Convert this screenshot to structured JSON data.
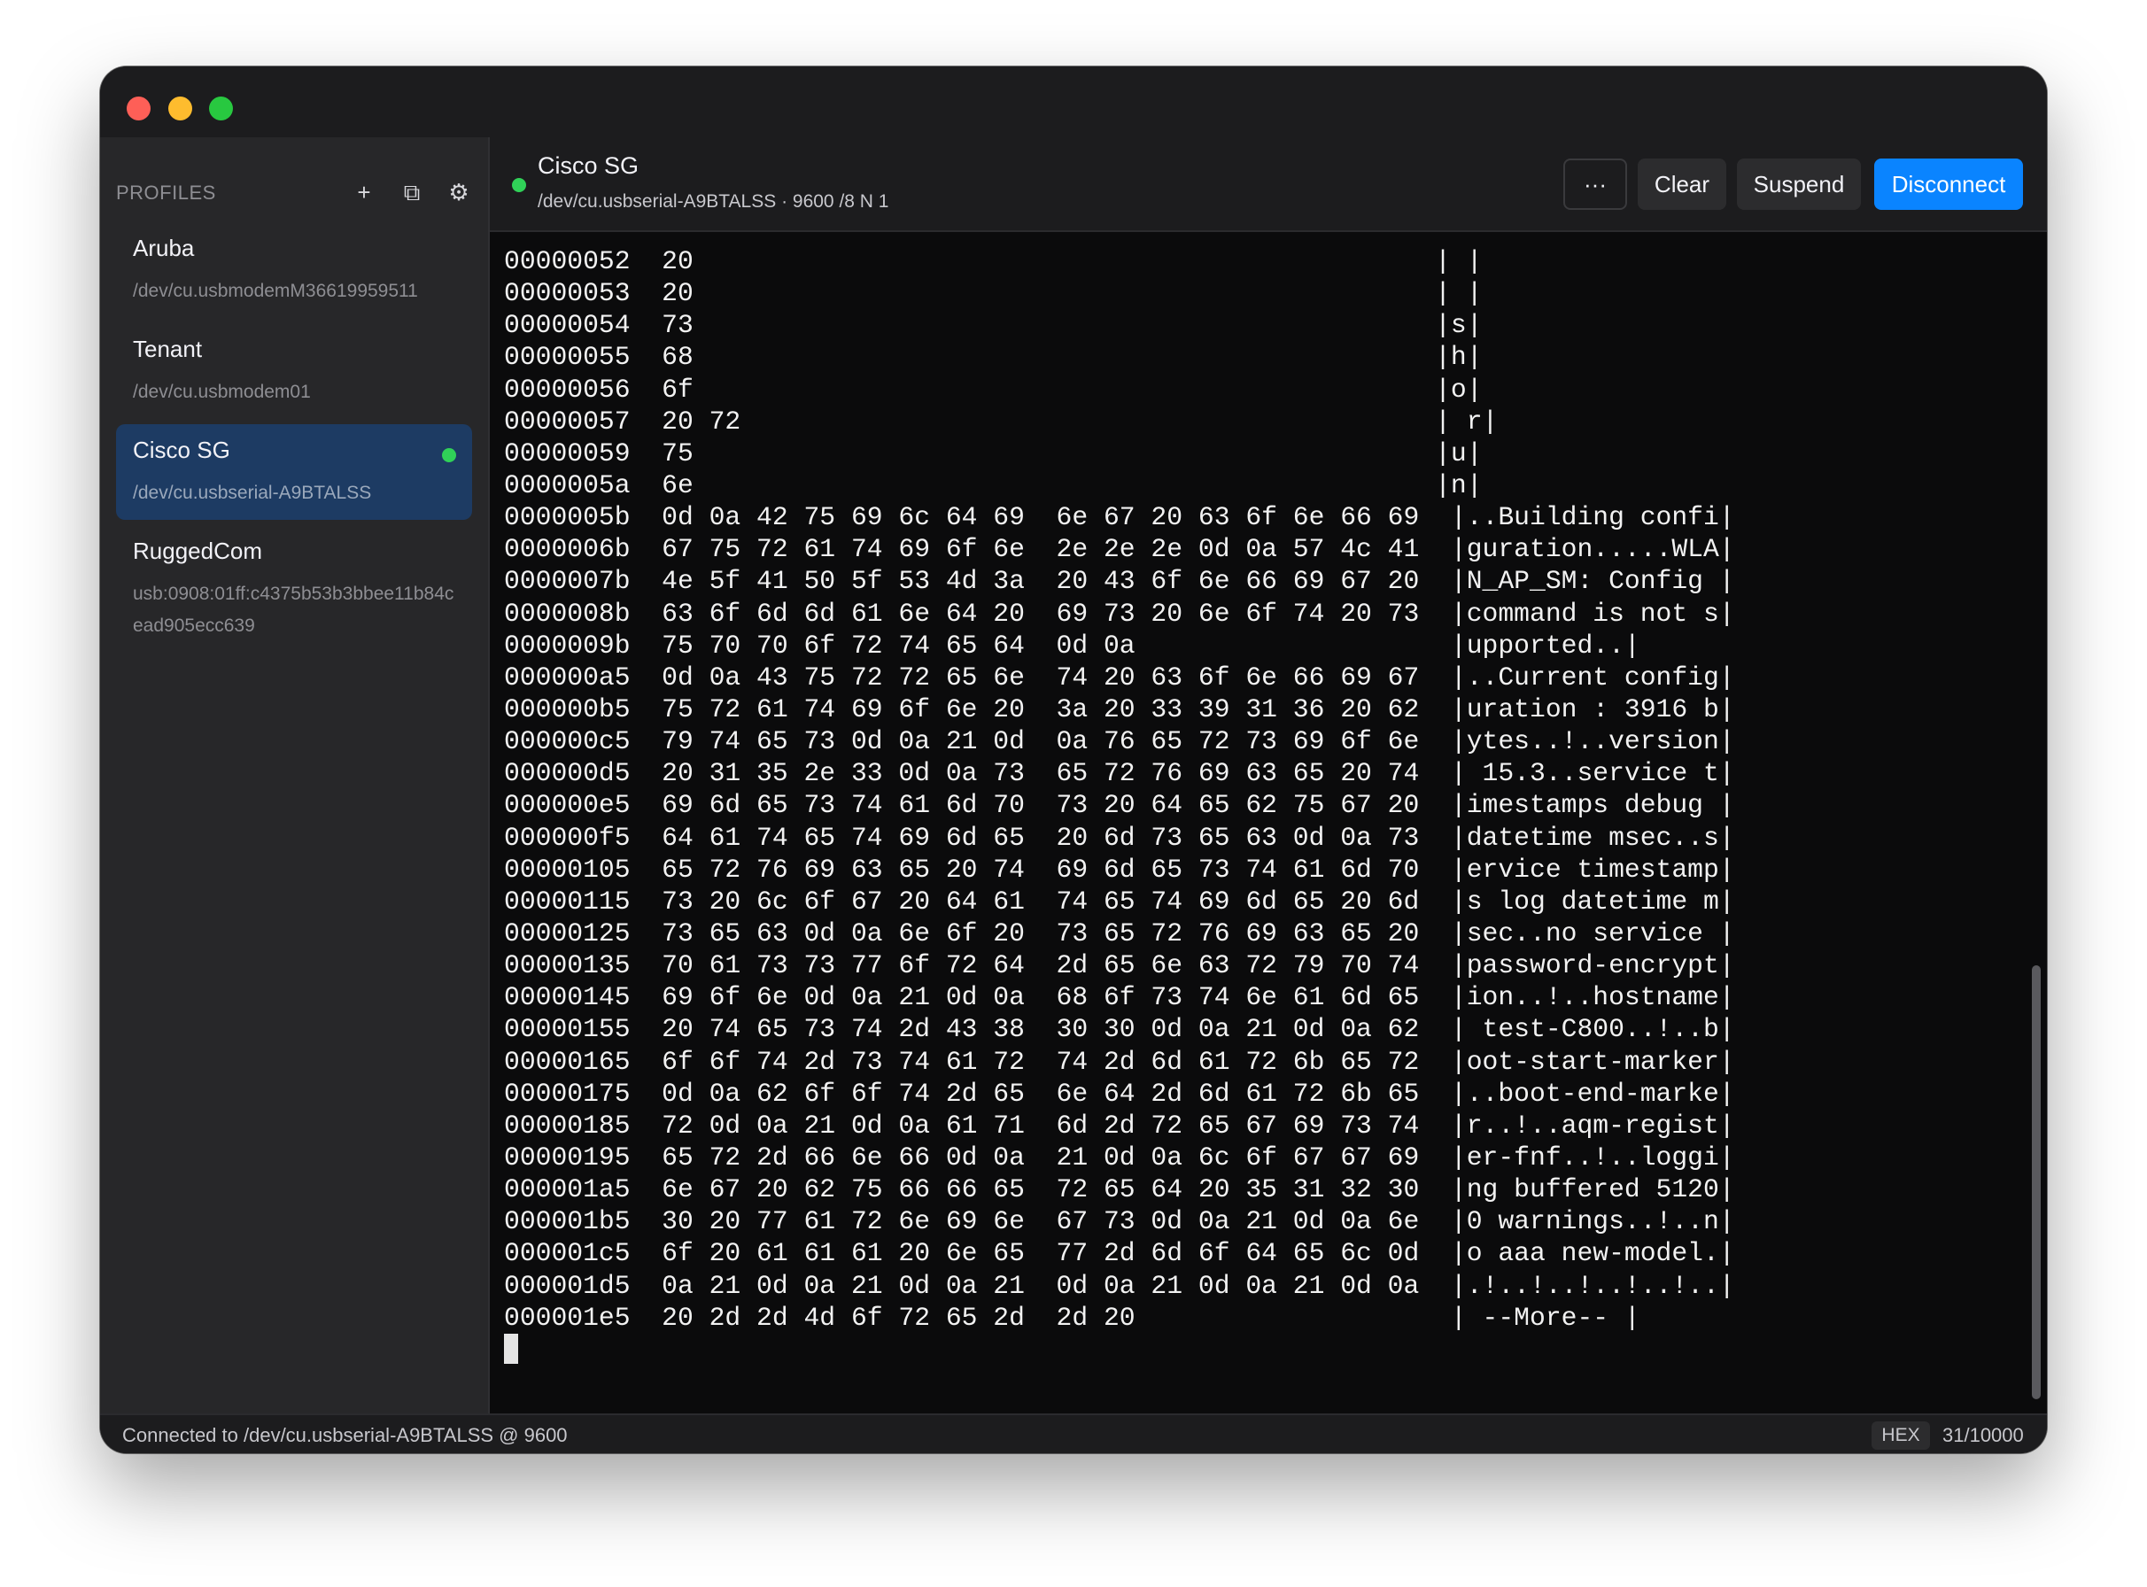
{
  "sidebar": {
    "title": "PROFILES",
    "actions": {
      "add_glyph": "+",
      "duplicate_glyph": "⧉",
      "settings_glyph": "⚙"
    },
    "profiles": [
      {
        "name": "Aruba",
        "path": "/dev/cu.usbmodemM36619959511",
        "active": false,
        "connected": false
      },
      {
        "name": "Tenant",
        "path": "/dev/cu.usbmodem01",
        "active": false,
        "connected": false
      },
      {
        "name": "Cisco SG",
        "path": "/dev/cu.usbserial-A9BTALSS",
        "active": true,
        "connected": true
      },
      {
        "name": "RuggedCom",
        "path": "usb:0908:01ff:c4375b53b3bbee11b84cead905ecc639",
        "active": false,
        "connected": false
      }
    ]
  },
  "session": {
    "title": "Cisco SG",
    "info": "/dev/cu.usbserial-A9BTALSS · 9600 /8 N 1",
    "buttons": {
      "more": "···",
      "clear": "Clear",
      "suspend": "Suspend",
      "disconnect": "Disconnect"
    }
  },
  "terminal": {
    "lines": [
      "00000052  20                                               | |",
      "00000053  20                                               | |",
      "00000054  73                                               |s|",
      "00000055  68                                               |h|",
      "00000056  6f                                               |o|",
      "00000057  20 72                                            | r|",
      "00000059  75                                               |u|",
      "0000005a  6e                                               |n|",
      "0000005b  0d 0a 42 75 69 6c 64 69  6e 67 20 63 6f 6e 66 69  |..Building confi|",
      "0000006b  67 75 72 61 74 69 6f 6e  2e 2e 2e 0d 0a 57 4c 41  |guration.....WLA|",
      "0000007b  4e 5f 41 50 5f 53 4d 3a  20 43 6f 6e 66 69 67 20  |N_AP_SM: Config |",
      "0000008b  63 6f 6d 6d 61 6e 64 20  69 73 20 6e 6f 74 20 73  |command is not s|",
      "0000009b  75 70 70 6f 72 74 65 64  0d 0a                    |upported..|",
      "000000a5  0d 0a 43 75 72 72 65 6e  74 20 63 6f 6e 66 69 67  |..Current config|",
      "000000b5  75 72 61 74 69 6f 6e 20  3a 20 33 39 31 36 20 62  |uration : 3916 b|",
      "000000c5  79 74 65 73 0d 0a 21 0d  0a 76 65 72 73 69 6f 6e  |ytes..!..version|",
      "000000d5  20 31 35 2e 33 0d 0a 73  65 72 76 69 63 65 20 74  | 15.3..service t|",
      "000000e5  69 6d 65 73 74 61 6d 70  73 20 64 65 62 75 67 20  |imestamps debug |",
      "000000f5  64 61 74 65 74 69 6d 65  20 6d 73 65 63 0d 0a 73  |datetime msec..s|",
      "00000105  65 72 76 69 63 65 20 74  69 6d 65 73 74 61 6d 70  |ervice timestamp|",
      "00000115  73 20 6c 6f 67 20 64 61  74 65 74 69 6d 65 20 6d  |s log datetime m|",
      "00000125  73 65 63 0d 0a 6e 6f 20  73 65 72 76 69 63 65 20  |sec..no service |",
      "00000135  70 61 73 73 77 6f 72 64  2d 65 6e 63 72 79 70 74  |password-encrypt|",
      "00000145  69 6f 6e 0d 0a 21 0d 0a  68 6f 73 74 6e 61 6d 65  |ion..!..hostname|",
      "00000155  20 74 65 73 74 2d 43 38  30 30 0d 0a 21 0d 0a 62  | test-C800..!..b|",
      "00000165  6f 6f 74 2d 73 74 61 72  74 2d 6d 61 72 6b 65 72  |oot-start-marker|",
      "00000175  0d 0a 62 6f 6f 74 2d 65  6e 64 2d 6d 61 72 6b 65  |..boot-end-marke|",
      "00000185  72 0d 0a 21 0d 0a 61 71  6d 2d 72 65 67 69 73 74  |r..!..aqm-regist|",
      "00000195  65 72 2d 66 6e 66 0d 0a  21 0d 0a 6c 6f 67 67 69  |er-fnf..!..loggi|",
      "000001a5  6e 67 20 62 75 66 66 65  72 65 64 20 35 31 32 30  |ng buffered 5120|",
      "000001b5  30 20 77 61 72 6e 69 6e  67 73 0d 0a 21 0d 0a 6e  |0 warnings..!..n|",
      "000001c5  6f 20 61 61 61 20 6e 65  77 2d 6d 6f 64 65 6c 0d  |o aaa new-model.|",
      "000001d5  0a 21 0d 0a 21 0d 0a 21  0d 0a 21 0d 0a 21 0d 0a  |.!..!..!..!..!..|",
      "000001e5  20 2d 2d 4d 6f 72 65 2d  2d 20                    | --More-- |"
    ]
  },
  "status": {
    "text": "Connected to /dev/cu.usbserial-A9BTALSS @ 9600",
    "mode": "HEX",
    "line_count": "31/10000"
  },
  "colors": {
    "accent": "#0a84ff",
    "connected": "#30d158",
    "active_profile": "#1d3b63"
  }
}
